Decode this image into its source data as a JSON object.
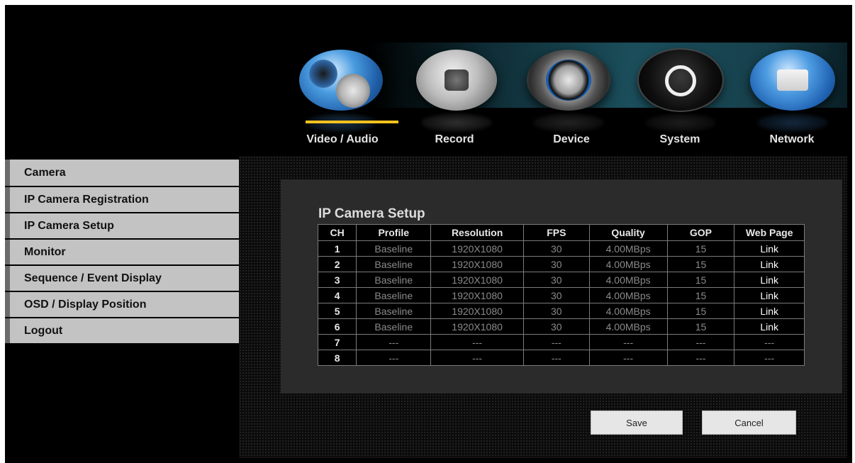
{
  "nav": {
    "items": [
      {
        "label": "Video / Audio",
        "icon": "video-audio-icon",
        "active": true
      },
      {
        "label": "Record",
        "icon": "record-icon",
        "active": false
      },
      {
        "label": "Device",
        "icon": "device-icon",
        "active": false
      },
      {
        "label": "System",
        "icon": "system-icon",
        "active": false
      },
      {
        "label": "Network",
        "icon": "network-icon",
        "active": false
      }
    ],
    "active_color": "#f3c21f"
  },
  "sidebar": {
    "items": [
      {
        "label": "Camera"
      },
      {
        "label": "IP Camera Registration"
      },
      {
        "label": "IP Camera Setup"
      },
      {
        "label": "Monitor"
      },
      {
        "label": "Sequence / Event Display"
      },
      {
        "label": "OSD / Display Position"
      },
      {
        "label": "Logout"
      }
    ]
  },
  "panel": {
    "title": "IP Camera Setup",
    "columns": [
      "CH",
      "Profile",
      "Resolution",
      "FPS",
      "Quality",
      "GOP",
      "Web Page"
    ],
    "rows": [
      [
        "1",
        "Baseline",
        "1920X1080",
        "30",
        "4.00MBps",
        "15",
        "Link"
      ],
      [
        "2",
        "Baseline",
        "1920X1080",
        "30",
        "4.00MBps",
        "15",
        "Link"
      ],
      [
        "3",
        "Baseline",
        "1920X1080",
        "30",
        "4.00MBps",
        "15",
        "Link"
      ],
      [
        "4",
        "Baseline",
        "1920X1080",
        "30",
        "4.00MBps",
        "15",
        "Link"
      ],
      [
        "5",
        "Baseline",
        "1920X1080",
        "30",
        "4.00MBps",
        "15",
        "Link"
      ],
      [
        "6",
        "Baseline",
        "1920X1080",
        "30",
        "4.00MBps",
        "15",
        "Link"
      ],
      [
        "7",
        "---",
        "---",
        "---",
        "---",
        "---",
        "---"
      ],
      [
        "8",
        "---",
        "---",
        "---",
        "---",
        "---",
        "---"
      ]
    ]
  },
  "buttons": {
    "save": "Save",
    "cancel": "Cancel"
  }
}
